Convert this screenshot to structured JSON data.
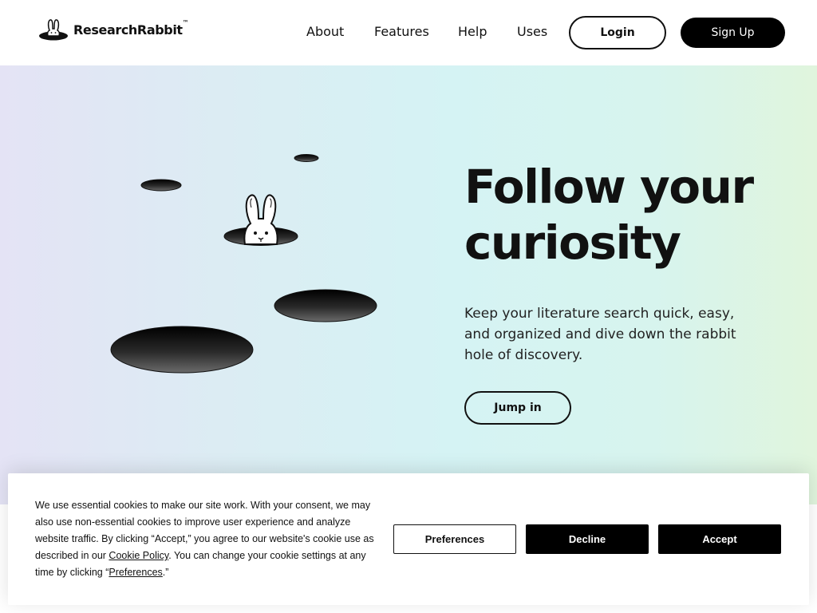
{
  "header": {
    "logo_text": "ResearchRabbit",
    "logo_tm": "™",
    "nav": [
      {
        "label": "About"
      },
      {
        "label": "Features"
      },
      {
        "label": "Help"
      },
      {
        "label": "Uses"
      }
    ],
    "login_label": "Login",
    "signup_label": "Sign Up"
  },
  "hero": {
    "title_line1": "Follow your",
    "title_line2": "curiosity",
    "description": "Keep your literature search quick, easy, and organized and dive down the rabbit hole of discovery.",
    "cta_label": "Jump in"
  },
  "cookie": {
    "text_part1": "We use essential cookies to make our site work. With your consent, we may also use non-essential cookies to improve user experience and analyze website traffic. By clicking “Accept,” you agree to our website's cookie use as described in our ",
    "cookie_policy_link": "Cookie Policy",
    "text_part2": ". You can change your cookie settings at any time by clicking “",
    "preferences_link": "Preferences",
    "text_part3": ".”",
    "preferences_label": "Preferences",
    "decline_label": "Decline",
    "accept_label": "Accept"
  },
  "colors": {
    "primary": "#000000",
    "background": "#ffffff"
  }
}
